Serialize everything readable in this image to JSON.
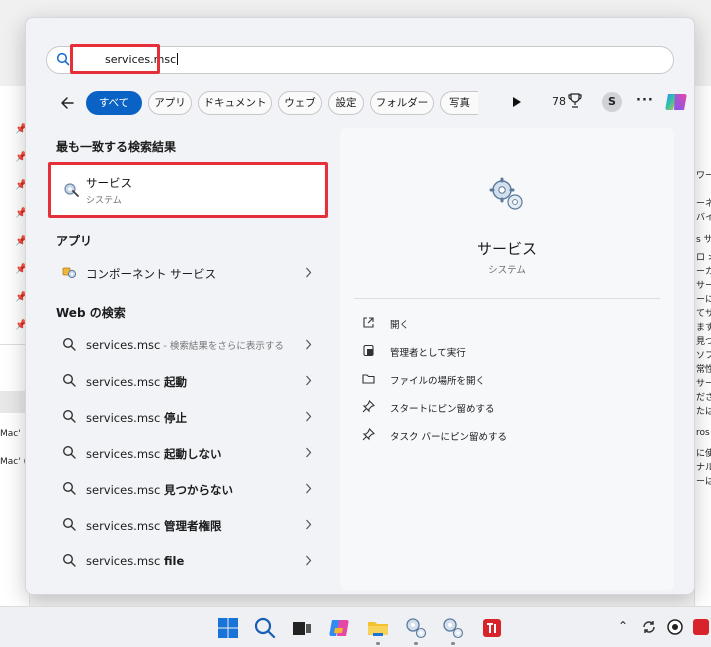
{
  "search": {
    "value": "services.msc"
  },
  "filters": {
    "chips": [
      "すべて",
      "アプリ",
      "ドキュメント",
      "ウェブ",
      "設定",
      "フォルダー",
      "写真"
    ],
    "points": "78",
    "avatar_initial": "S"
  },
  "results": {
    "best_match_heading": "最も一致する検索結果",
    "best_match": {
      "title": "サービス",
      "subtitle": "システム"
    },
    "apps_heading": "アプリ",
    "apps": [
      {
        "label": "コンポーネント サービス"
      }
    ],
    "web_heading": "Web の検索",
    "web": [
      {
        "query": "services.msc",
        "hint": " - 検索結果をさらに表示する",
        "bold": ""
      },
      {
        "query": "services.msc ",
        "hint": "",
        "bold": "起動"
      },
      {
        "query": "services.msc ",
        "hint": "",
        "bold": "停止"
      },
      {
        "query": "services.msc ",
        "hint": "",
        "bold": "起動しない"
      },
      {
        "query": "services.msc ",
        "hint": "",
        "bold": "見つからない"
      },
      {
        "query": "services.msc ",
        "hint": "",
        "bold": "管理者権限"
      },
      {
        "query": "services.msc ",
        "hint": "",
        "bold": "file"
      }
    ]
  },
  "preview": {
    "title": "サービス",
    "subtitle": "システム",
    "actions": [
      "開く",
      "管理者として実行",
      "ファイルの場所を開く",
      "スタートにピン留めする",
      "タスク バーにピン留めする"
    ]
  },
  "background": {
    "left_texts": [
      "Mac'",
      "Mac' (V"
    ],
    "right_texts": [
      "ワー",
      "ーネ",
      "バイ",
      "s サ",
      "ロ >",
      "ーカ",
      "サー",
      "ーに",
      "てサ",
      "ます",
      "見つ",
      "ソフ",
      "常性",
      "サー",
      "ださ",
      "たは",
      "ros",
      "に使",
      "ナル",
      "ーは"
    ]
  },
  "colors": {
    "accent": "#0a62c4",
    "highlight_box": "#e5303a"
  }
}
